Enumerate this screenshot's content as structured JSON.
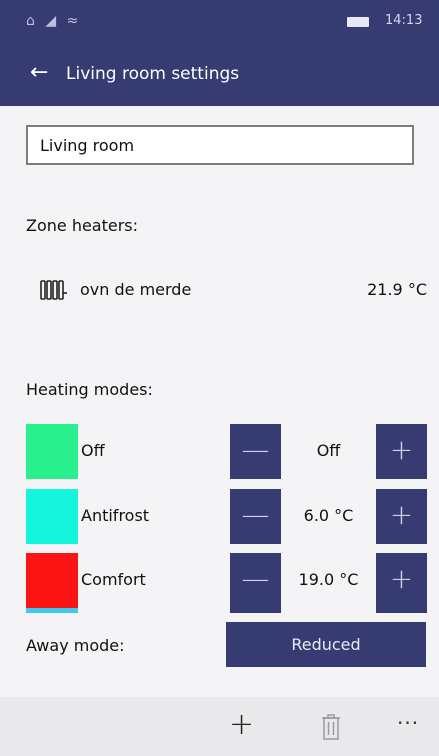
{
  "status_bar": {
    "time": "14:13"
  },
  "header": {
    "title": "Living room settings"
  },
  "zone": {
    "name": "Living room"
  },
  "heaters_section": {
    "label": "Zone heaters:",
    "heaters": [
      {
        "name": "ovn de merde",
        "temperature": "21.9 °C",
        "icon": "radiator-icon"
      }
    ]
  },
  "modes_section": {
    "label": "Heating modes:",
    "modes": [
      {
        "name": "Off",
        "value": "Off",
        "color": "#28f08c"
      },
      {
        "name": "Antifrost",
        "value": "6.0 °C",
        "color": "#14f5dc"
      },
      {
        "name": "Comfort",
        "value": "19.0 °C",
        "color": "#fa1414"
      }
    ],
    "minus_label": "—",
    "plus_label": "+"
  },
  "away": {
    "label": "Away mode:",
    "value": "Reduced"
  },
  "app_bar": {
    "add_label": "+",
    "more_label": "···"
  },
  "colors": {
    "accent": "#363c72",
    "background": "#f4f4f7",
    "app_bar": "#e9e9ec"
  }
}
